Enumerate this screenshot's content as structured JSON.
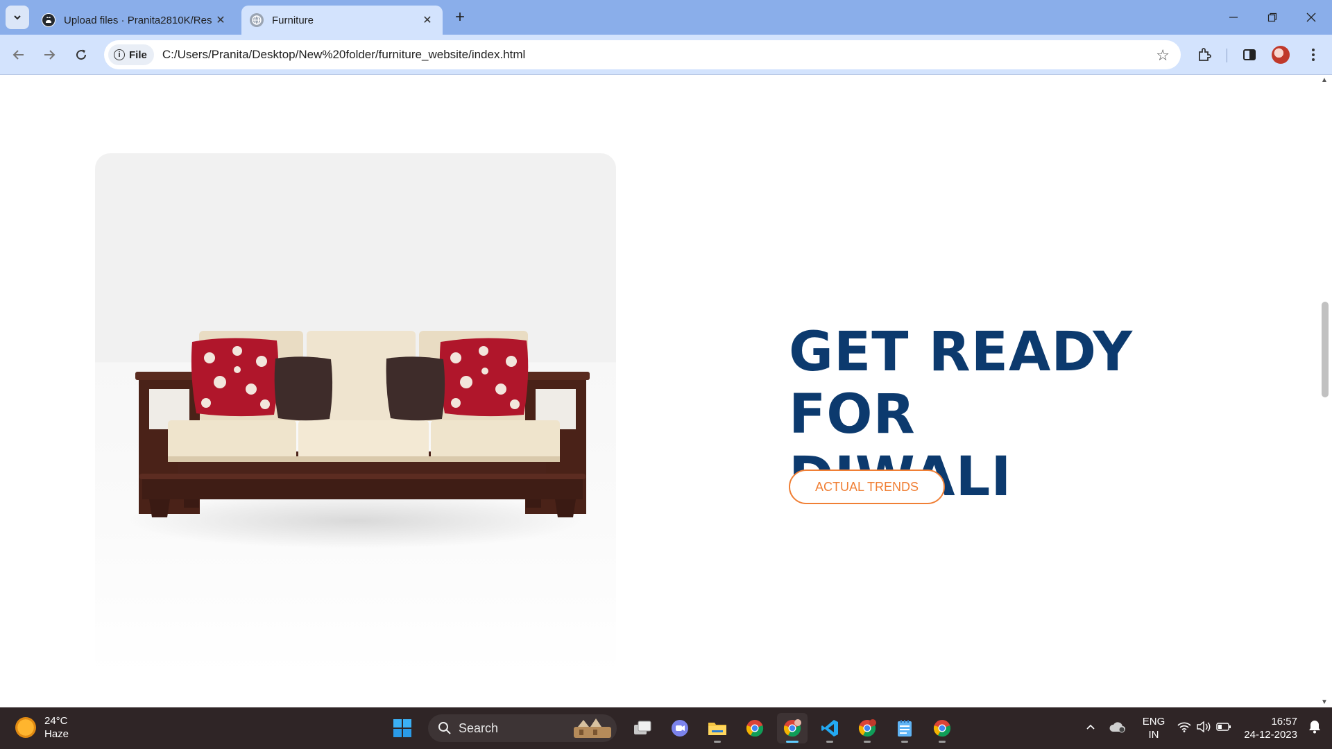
{
  "browser": {
    "tabs": [
      {
        "title": "Upload files · Pranita2810K/Res",
        "active": false
      },
      {
        "title": "Furniture",
        "active": true
      }
    ],
    "new_tab_symbol": "+",
    "address": {
      "chip_label": "File",
      "url": "C:/Users/Pranita/Desktop/New%20folder/furniture_website/index.html"
    }
  },
  "page": {
    "heading_line1": "GET READY FOR",
    "heading_line2": "DIWALI",
    "cta_label": "ACTUAL TRENDS",
    "colors": {
      "heading": "#0c3a6e",
      "accent": "#f07f35"
    }
  },
  "taskbar": {
    "weather": {
      "temp": "24°C",
      "condition": "Haze"
    },
    "search_placeholder": "Search",
    "language_line1": "ENG",
    "language_line2": "IN",
    "time": "16:57",
    "date": "24-12-2023"
  }
}
